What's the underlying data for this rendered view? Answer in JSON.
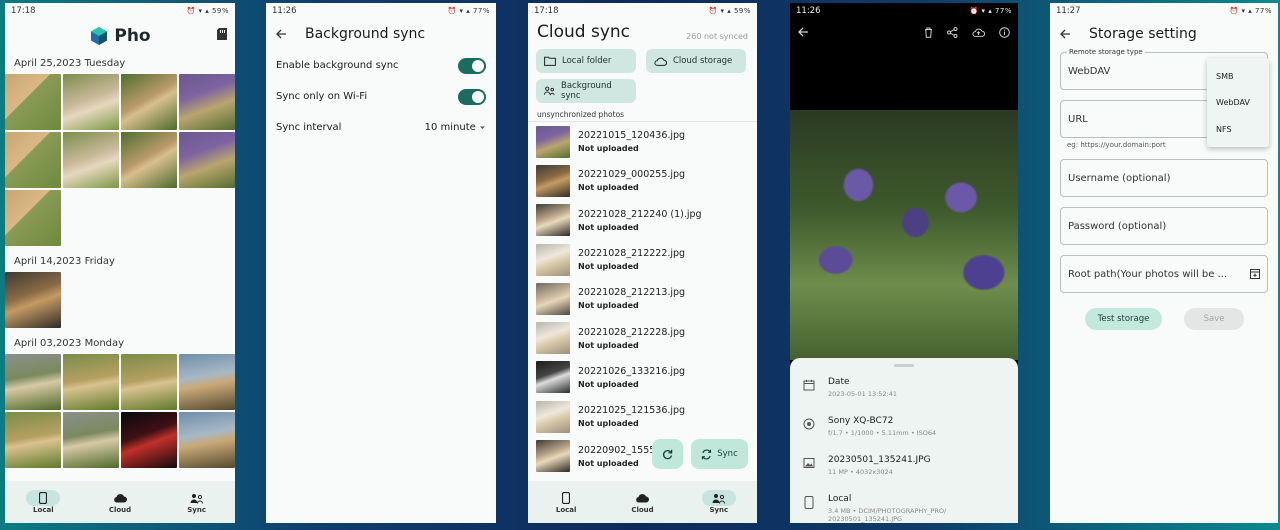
{
  "status": {
    "p1": {
      "time": "17:18",
      "battery": "59%"
    },
    "p2": {
      "time": "11:26",
      "battery": "77%"
    },
    "p3": {
      "time": "17:18",
      "battery": "59%"
    },
    "p4": {
      "time": "11:26",
      "battery": "77%"
    },
    "p5": {
      "time": "11:27",
      "battery": "77%"
    }
  },
  "gallery": {
    "app_name": "Pho",
    "groups": [
      {
        "date": "April 25,2023 Tuesday"
      },
      {
        "date": "April 14,2023 Friday"
      },
      {
        "date": "April 03,2023 Monday"
      }
    ]
  },
  "nav": {
    "local": "Local",
    "cloud": "Cloud",
    "sync": "Sync"
  },
  "background_sync": {
    "title": "Background sync",
    "enable_label": "Enable background sync",
    "wifi_label": "Sync only on Wi-Fi",
    "interval_label": "Sync interval",
    "interval_value": "10 minute",
    "enable_on": true,
    "wifi_on": true
  },
  "cloud_sync": {
    "title": "Cloud sync",
    "not_synced": "260 not synced",
    "chips": {
      "local_folder": "Local folder",
      "cloud_storage": "Cloud storage",
      "background_sync": "Background sync"
    },
    "section": "unsynchronized photos",
    "status_text": "Not uploaded",
    "files": [
      "20221015_120436.jpg",
      "20221029_000255.jpg",
      "20221028_212240 (1).jpg",
      "20221028_212222.jpg",
      "20221028_212213.jpg",
      "20221028_212228.jpg",
      "20221026_133216.jpg",
      "20221025_121536.jpg",
      "20220902_1555"
    ],
    "sync_button": "Sync"
  },
  "viewer": {
    "date_label": "Date",
    "date_value": "2023-05-01 13:52:41",
    "camera": "Sony XQ-BC72",
    "camera_specs": "f/1.7 • 1/1000 • 5.11mm • ISO64",
    "filename": "20230501_135241.JPG",
    "file_specs": "11 MP • 4032x3024",
    "location_label": "Local",
    "location_specs": "3.4 MB • DCIM/PHOTOGRAPHY_PRO/",
    "location_path": "20230501_135241.JPG"
  },
  "storage": {
    "title": "Storage setting",
    "type_label": "Remote storage type",
    "type_value": "WebDAV",
    "url_label": "URL",
    "url_helper": "eg: https://your.domain:port",
    "username_label": "Username (optional)",
    "password_label": "Password (optional)",
    "root_label": "Root path(Your photos will be ...",
    "options": [
      "SMB",
      "WebDAV",
      "NFS"
    ],
    "test_button": "Test storage",
    "save_button": "Save"
  }
}
